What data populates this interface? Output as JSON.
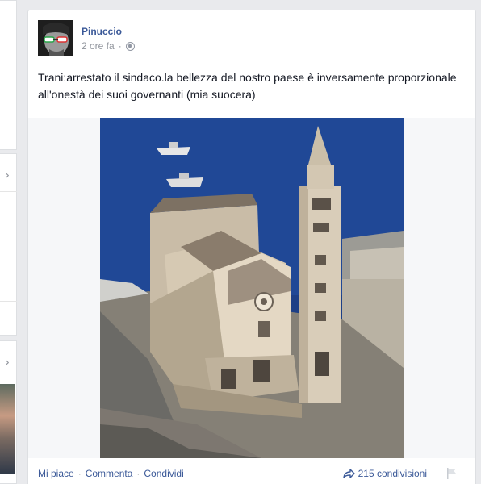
{
  "post": {
    "author": "Pinuccio",
    "time": "2 ore fa",
    "text": "Trani:arrestato il sindaco.la bellezza del nostro paese è inversamente proporzionale all'onestà dei suoi governanti (mia suocera)",
    "actions": {
      "like": "Mi piace",
      "comment": "Commenta",
      "share": "Condividi",
      "separator": "·"
    },
    "shares": "215 condivisioni"
  },
  "icons": {
    "privacy": "globe-icon",
    "share_count": "share-arrow-icon",
    "report": "flag-icon",
    "left_chevron": "chevron-right-icon"
  },
  "colors": {
    "link": "#3b5998",
    "meta": "#90949c",
    "text": "#141823",
    "background": "#e9eaed"
  }
}
